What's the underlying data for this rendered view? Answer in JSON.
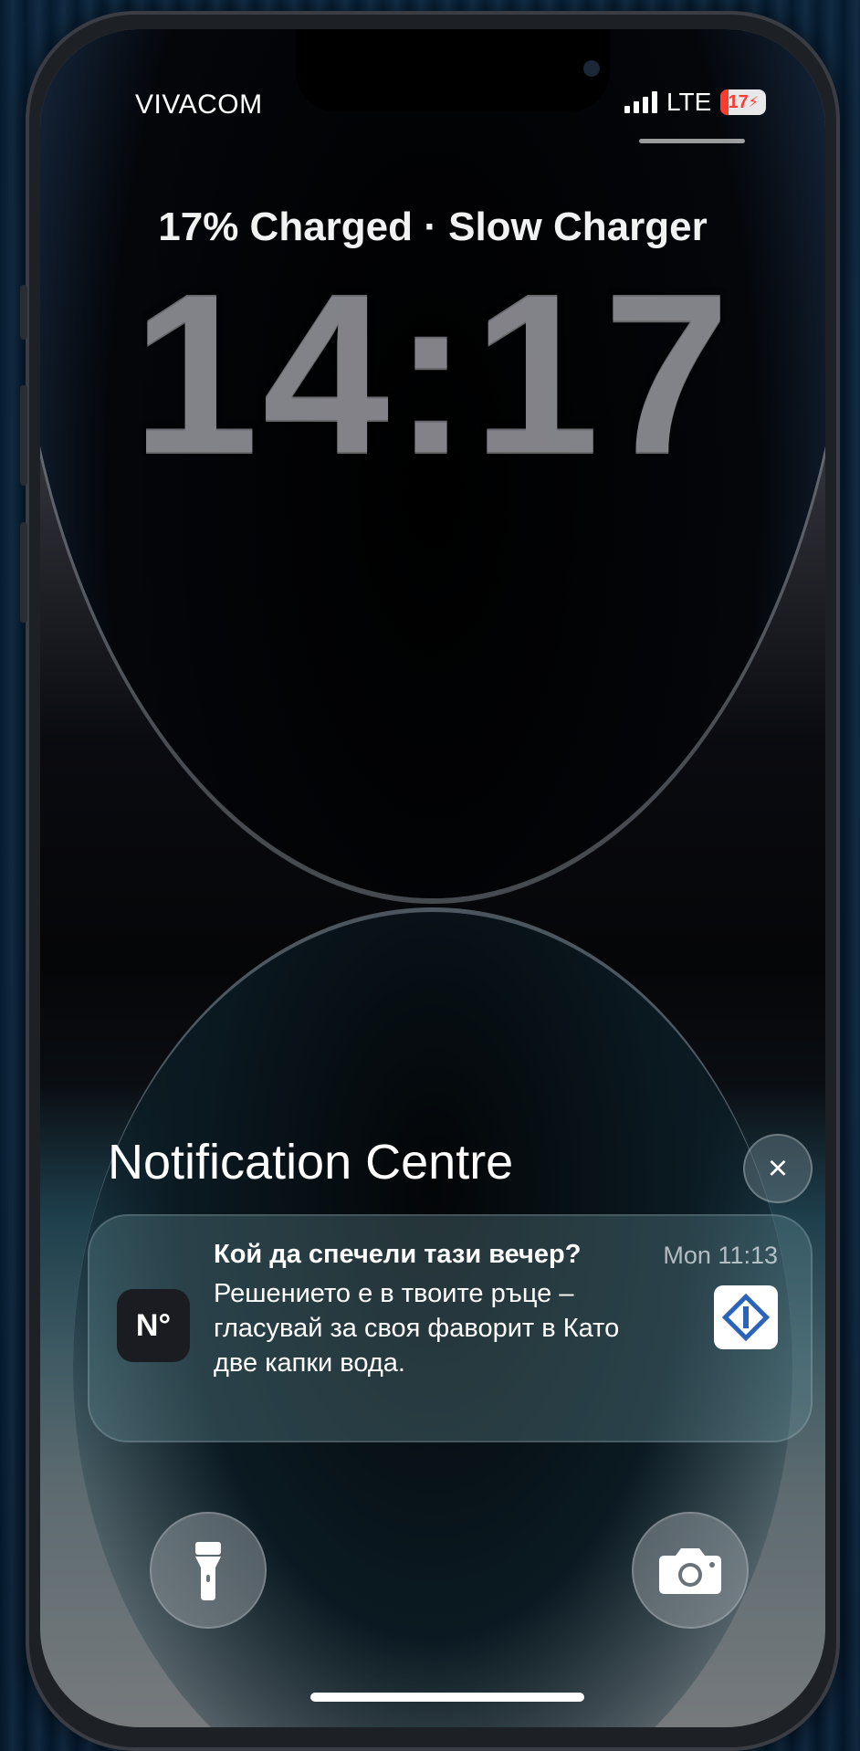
{
  "status_bar": {
    "carrier": "VIVACOM",
    "network": "LTE",
    "battery_level": "17",
    "battery_fraction": 0.17,
    "signal_icon": "signal-bars-icon",
    "charging_icon": "bolt-icon"
  },
  "lock_screen": {
    "charge_status": "17% Charged · Slow Charger",
    "time": "14:17"
  },
  "notification_centre": {
    "title": "Notification Centre",
    "close_icon": "×",
    "notifications": [
      {
        "title": "Кой да спечели тази вечер?",
        "time": "Mon 11:13",
        "body": "Решението е в твоите ръце – гласувай за своя фаворит в Като две капки вода.",
        "app_icon_glyph": "N°",
        "app_icon_name": "app-icon"
      }
    ]
  },
  "quick_actions": {
    "left_icon": "flashlight-icon",
    "right_icon": "camera-icon"
  },
  "colors": {
    "accent_battery_low": "#ff3b30",
    "text": "#ffffff"
  }
}
